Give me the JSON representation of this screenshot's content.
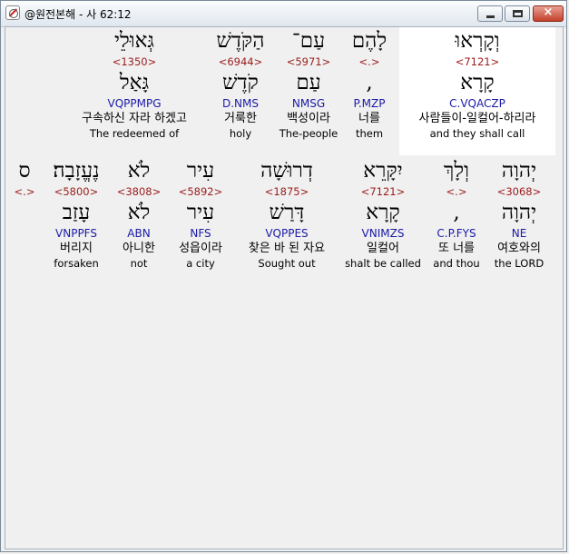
{
  "window": {
    "title": "@원전본해 - 사 62:12",
    "controls": {
      "minimize": "minimize-icon",
      "maximize": "maximize-icon",
      "close": "close-icon",
      "close_glyph": "×"
    }
  },
  "colors": {
    "strong": "#9b1c1c",
    "morph": "#1a1aa8",
    "highlight": "#ffffff",
    "background": "#f0f0f0"
  },
  "rows": [
    {
      "words": [
        {
          "heb": "וְקָרְאוּ",
          "strong": "<7121>",
          "lemma": "קָרָא",
          "morph": "C.VQACZP",
          "kor": "사람들이-일컬어-하리라",
          "eng": "and they shall call",
          "highlighted": true
        },
        {
          "heb": "לָהֶם",
          "strong": "<.>",
          "lemma": ",",
          "morph": "P.MZP",
          "kor": "너를",
          "eng": "them"
        },
        {
          "heb": "עַם־",
          "strong": "<5971>",
          "lemma": "עַם",
          "morph": "NMSG",
          "kor": "백성이라",
          "eng": "The-people"
        },
        {
          "heb": "הַקֹּדֶשׁ",
          "strong": "<6944>",
          "lemma": "קֹדֶשׁ",
          "morph": "D.NMS",
          "kor": "거룩한",
          "eng": "holy"
        },
        {
          "heb": "גְּאוּלֵי",
          "strong": "<1350>",
          "lemma": "גָּאַל",
          "morph": "VQPPMPG",
          "kor": "구속하신 자라 하겠고",
          "eng": "The redeemed of"
        }
      ]
    },
    {
      "words": [
        {
          "heb": "יְהוָה",
          "strong": "<3068>",
          "lemma": "יְהוָה",
          "morph": "NE",
          "kor": "여호와의",
          "eng": "the LORD"
        },
        {
          "heb": "וְלָךְ",
          "strong": "<.>",
          "lemma": ",",
          "morph": "C.P.FYS",
          "kor": "또 너를",
          "eng": "and thou"
        },
        {
          "heb": "יִקָּרֵא",
          "strong": "<7121>",
          "lemma": "קָרָא",
          "morph": "VNIMZS",
          "kor": "일컬어",
          "eng": "shalt be called"
        },
        {
          "heb": "דְרוּשָׁה",
          "strong": "<1875>",
          "lemma": "דָּרַשׁ",
          "morph": "VQPPES",
          "kor": "찾은 바 된 자요",
          "eng": "Sought out"
        },
        {
          "heb": "עִיר",
          "strong": "<5892>",
          "lemma": "עִיר",
          "morph": "NFS",
          "kor": "성읍이라",
          "eng": "a city"
        },
        {
          "heb": "לֹא",
          "strong": "<3808>",
          "lemma": "לֹא",
          "morph": "ABN",
          "kor": "아니한",
          "eng": "not"
        },
        {
          "heb": "נֶעֱזָבָה׃",
          "strong": "<5800>",
          "lemma": "עָזַב",
          "morph": "VNPPFS",
          "kor": "버리지",
          "eng": "forsaken"
        },
        {
          "heb": "ס",
          "strong": "<.>"
        }
      ]
    }
  ]
}
